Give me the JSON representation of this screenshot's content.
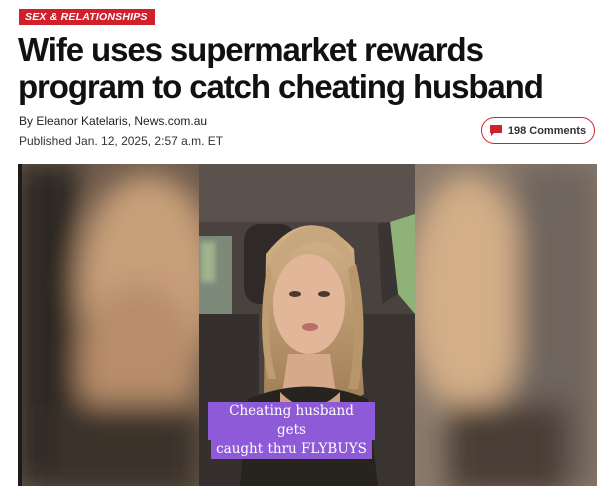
{
  "article": {
    "section_tag": "SEX & RELATIONSHIPS",
    "headline": "Wife uses supermarket rewards program to catch cheating husband",
    "byline": "By Eleanor Katelaris, News.com.au",
    "published": "Published Jan. 12, 2025, 2:57 a.m. ET"
  },
  "comments": {
    "label": "198 Comments",
    "icon": "comment-bubble-icon"
  },
  "video": {
    "caption_line1": "Cheating husband gets",
    "caption_line2": "caught thru FLYBUYS"
  },
  "colors": {
    "accent": "#d11f2b",
    "caption_bg": "#8e5ad8"
  }
}
